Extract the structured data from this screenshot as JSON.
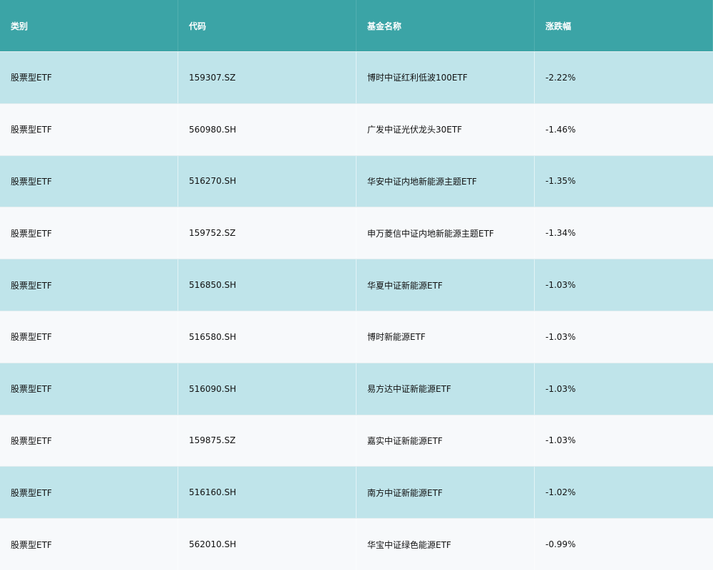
{
  "table": {
    "headers": [
      "类别",
      "代码",
      "基金名称",
      "涨跌幅"
    ],
    "rows": [
      {
        "category": "股票型ETF",
        "code": "159307.SZ",
        "name": "博时中证红利低波100ETF",
        "change": "-2.22%"
      },
      {
        "category": "股票型ETF",
        "code": "560980.SH",
        "name": "广发中证光伏龙头30ETF",
        "change": "-1.46%"
      },
      {
        "category": "股票型ETF",
        "code": "516270.SH",
        "name": "华安中证内地新能源主题ETF",
        "change": "-1.35%"
      },
      {
        "category": "股票型ETF",
        "code": "159752.SZ",
        "name": "申万菱信中证内地新能源主题ETF",
        "change": "-1.34%"
      },
      {
        "category": "股票型ETF",
        "code": "516850.SH",
        "name": "华夏中证新能源ETF",
        "change": "-1.03%"
      },
      {
        "category": "股票型ETF",
        "code": "516580.SH",
        "name": "博时新能源ETF",
        "change": "-1.03%"
      },
      {
        "category": "股票型ETF",
        "code": "516090.SH",
        "name": "易方达中证新能源ETF",
        "change": "-1.03%"
      },
      {
        "category": "股票型ETF",
        "code": "159875.SZ",
        "name": "嘉实中证新能源ETF",
        "change": "-1.03%"
      },
      {
        "category": "股票型ETF",
        "code": "516160.SH",
        "name": "南方中证新能源ETF",
        "change": "-1.02%"
      },
      {
        "category": "股票型ETF",
        "code": "562010.SH",
        "name": "华宝中证绿色能源ETF",
        "change": "-0.99%"
      }
    ]
  },
  "colors": {
    "header_bg": "#3ba4a6",
    "row_odd_bg": "#bfe4ea",
    "row_even_bg": "#f7f9fb"
  }
}
